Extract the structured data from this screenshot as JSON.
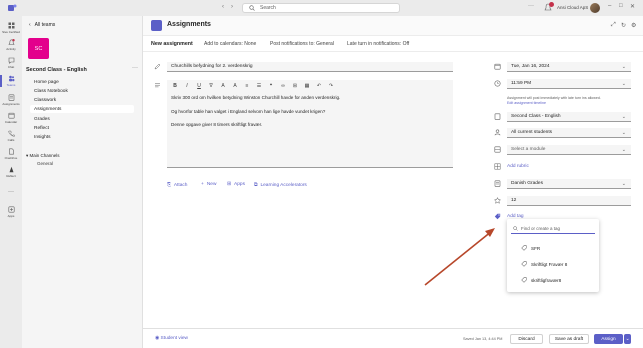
{
  "titlebar": {
    "search_placeholder": "Search",
    "more": "···",
    "user_name": "Ansi Cloud ApS"
  },
  "rail": {
    "items": [
      {
        "label": "Sive Certified",
        "icon": "grid-icon"
      },
      {
        "label": "Activity",
        "icon": "bell-icon"
      },
      {
        "label": "Chat",
        "icon": "chat-icon"
      },
      {
        "label": "Teams",
        "icon": "teams-icon"
      },
      {
        "label": "Assignments",
        "icon": "assignments-icon"
      },
      {
        "label": "Calendar",
        "icon": "calendar-icon"
      },
      {
        "label": "Calls",
        "icon": "phone-icon"
      },
      {
        "label": "OneDrive",
        "icon": "file-icon"
      },
      {
        "label": "Reflect",
        "icon": "reflect-icon"
      },
      {
        "label": "···",
        "icon": "more-icon"
      },
      {
        "label": "Apps",
        "icon": "apps-icon"
      }
    ]
  },
  "nav": {
    "back_label": "All teams",
    "class_initials": "SC",
    "class_name": "Second Class - English",
    "more": "···",
    "items": [
      "Home page",
      "Class Notebook",
      "Classwork",
      "Assignments",
      "Grades",
      "Reflect",
      "Insights"
    ],
    "channels_header": "Main Channels",
    "channel_general": "General"
  },
  "header": {
    "title": "Assignments"
  },
  "toolbar": {
    "new_assignment": "New assignment",
    "add_to_calendar": "Add to calendars: None",
    "post_notifications": "Post notifications to: General",
    "late_turn_in": "Late turn in notifications: Off"
  },
  "form": {
    "title_value": "Churchills befydning for 2. verdenskrig",
    "instructions": [
      "Skriv 300 ord om hvilken betydning Winston Churchill havde for anden verdenskrig.",
      "Og hvorfor table han valget i England selvom han lige havde vundet krigen?",
      "Denne opgave giver 8 timers skriftligt fravær."
    ],
    "editor_tools": [
      "B",
      "I",
      "U",
      "∇",
      "A",
      "A",
      "≡",
      "☰",
      "❝",
      "∞",
      "⊞",
      "▦",
      "↶",
      "↷"
    ],
    "attach": "Attach",
    "new": "New",
    "apps": "Apps",
    "learning_accelerators": "Learning Accelerators"
  },
  "side": {
    "date": "Tue, Jan 16, 2024",
    "time": "11:59 PM",
    "note_line1": "Assignment will post immediately with late turn ins allowed.",
    "note_link": "Edit assignment timeline",
    "class": "Second Class - English",
    "students": "All current students",
    "module_placeholder": "Select a module",
    "add_rubric": "Add rubric",
    "grading": "Danish Grades",
    "points": "12",
    "add_tag": "Add tag"
  },
  "tag_dropdown": {
    "placeholder": "Find or create a tag",
    "tags": [
      "SFR",
      "Skriftligt Fravær 8",
      "skriftligfravær8"
    ]
  },
  "footer": {
    "student_view": "Student view",
    "saved": "Saved Jan 13, 4:44 PM",
    "discard": "Discard",
    "save_draft": "Save as draft",
    "assign": "Assign",
    "assign_chevron": "⌄"
  },
  "colors": {
    "accent": "#5b5fc7",
    "class_tile": "#e3008c",
    "arrow": "#b7472a"
  }
}
